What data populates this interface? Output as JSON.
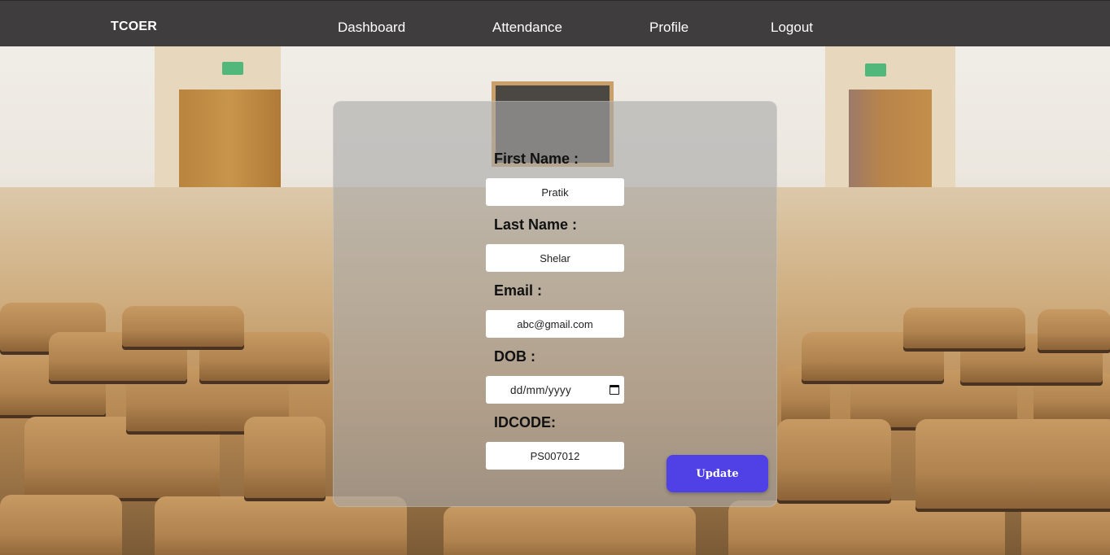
{
  "nav": {
    "brand": "TCOER",
    "links": [
      "Dashboard",
      "Attendance",
      "Profile",
      "Logout"
    ]
  },
  "form": {
    "first_name": {
      "label": "First Name :",
      "value": "Pratik"
    },
    "last_name": {
      "label": "Last Name :",
      "value": "Shelar"
    },
    "email": {
      "label": "Email :",
      "value": "abc@gmail.com"
    },
    "dob": {
      "label": "DOB :",
      "placeholder": "dd/mm/yyyy",
      "icon": "calendar-icon"
    },
    "idcode": {
      "label": "IDCODE:",
      "value": "PS007012"
    },
    "submit_label": "Update"
  },
  "colors": {
    "navbar": "#3f3d3e",
    "button": "#4f41e6"
  }
}
